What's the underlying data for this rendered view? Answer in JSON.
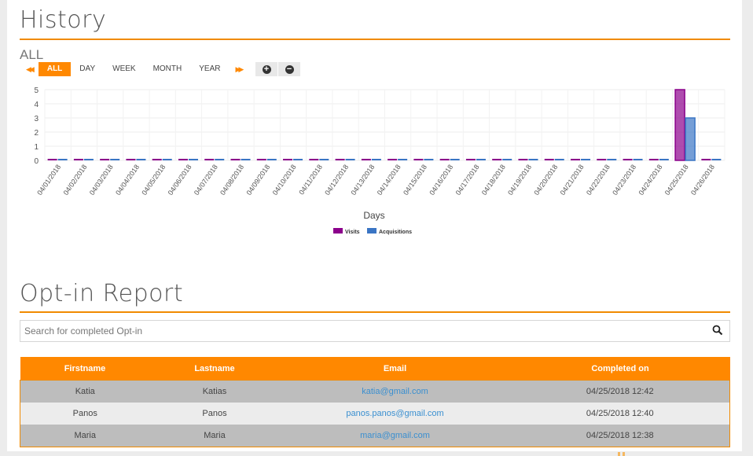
{
  "history": {
    "title": "History",
    "range_label": "ALL",
    "range_buttons": [
      "ALL",
      "DAY",
      "WEEK",
      "MONTH",
      "YEAR"
    ],
    "active_range": "ALL",
    "prev_icon": "rewind-icon",
    "next_icon": "fast-forward-icon",
    "zoom_in_icon": "zoom-in-icon",
    "zoom_out_icon": "zoom-out-icon"
  },
  "chart_data": {
    "type": "bar",
    "title": "",
    "xlabel": "Days",
    "ylabel": "",
    "ylim": [
      0,
      5
    ],
    "yticks": [
      0,
      1,
      2,
      3,
      4,
      5
    ],
    "grid": true,
    "legend_position": "bottom-center",
    "categories": [
      "04/01/2018",
      "04/02/2018",
      "04/03/2018",
      "04/04/2018",
      "04/05/2018",
      "04/06/2018",
      "04/07/2018",
      "04/08/2018",
      "04/09/2018",
      "04/10/2018",
      "04/11/2018",
      "04/12/2018",
      "04/13/2018",
      "04/14/2018",
      "04/15/2018",
      "04/16/2018",
      "04/17/2018",
      "04/18/2018",
      "04/19/2018",
      "04/20/2018",
      "04/21/2018",
      "04/22/2018",
      "04/23/2018",
      "04/24/2018",
      "04/25/2018",
      "04/26/2018"
    ],
    "series": [
      {
        "name": "Visits",
        "color": "#8b008b",
        "values": [
          0,
          0,
          0,
          0,
          0,
          0,
          0,
          0,
          0,
          0,
          0,
          0,
          0,
          0,
          0,
          0,
          0,
          0,
          0,
          0,
          0,
          0,
          0,
          0,
          5,
          0
        ]
      },
      {
        "name": "Acquisitions",
        "color": "#3a75c4",
        "values": [
          0,
          0,
          0,
          0,
          0,
          0,
          0,
          0,
          0,
          0,
          0,
          0,
          0,
          0,
          0,
          0,
          0,
          0,
          0,
          0,
          0,
          0,
          0,
          0,
          3,
          0
        ]
      }
    ]
  },
  "optin": {
    "title": "Opt-in Report",
    "search_placeholder": "Search for completed Opt-in",
    "search_value": "",
    "columns": [
      "Firstname",
      "Lastname",
      "Email",
      "Completed on"
    ],
    "rows": [
      {
        "firstname": "Katia",
        "lastname": "Katias",
        "email": "katia@gmail.com",
        "completed": "04/25/2018 12:42"
      },
      {
        "firstname": "Panos",
        "lastname": "Panos",
        "email": "panos.panos@gmail.com",
        "completed": "04/25/2018 12:40"
      },
      {
        "firstname": "Maria",
        "lastname": "Maria",
        "email": "maria@gmail.com",
        "completed": "04/25/2018 12:38"
      }
    ]
  },
  "colors": {
    "accent": "#ff8800",
    "rule": "#f08a00",
    "link": "#3a8fd0"
  }
}
